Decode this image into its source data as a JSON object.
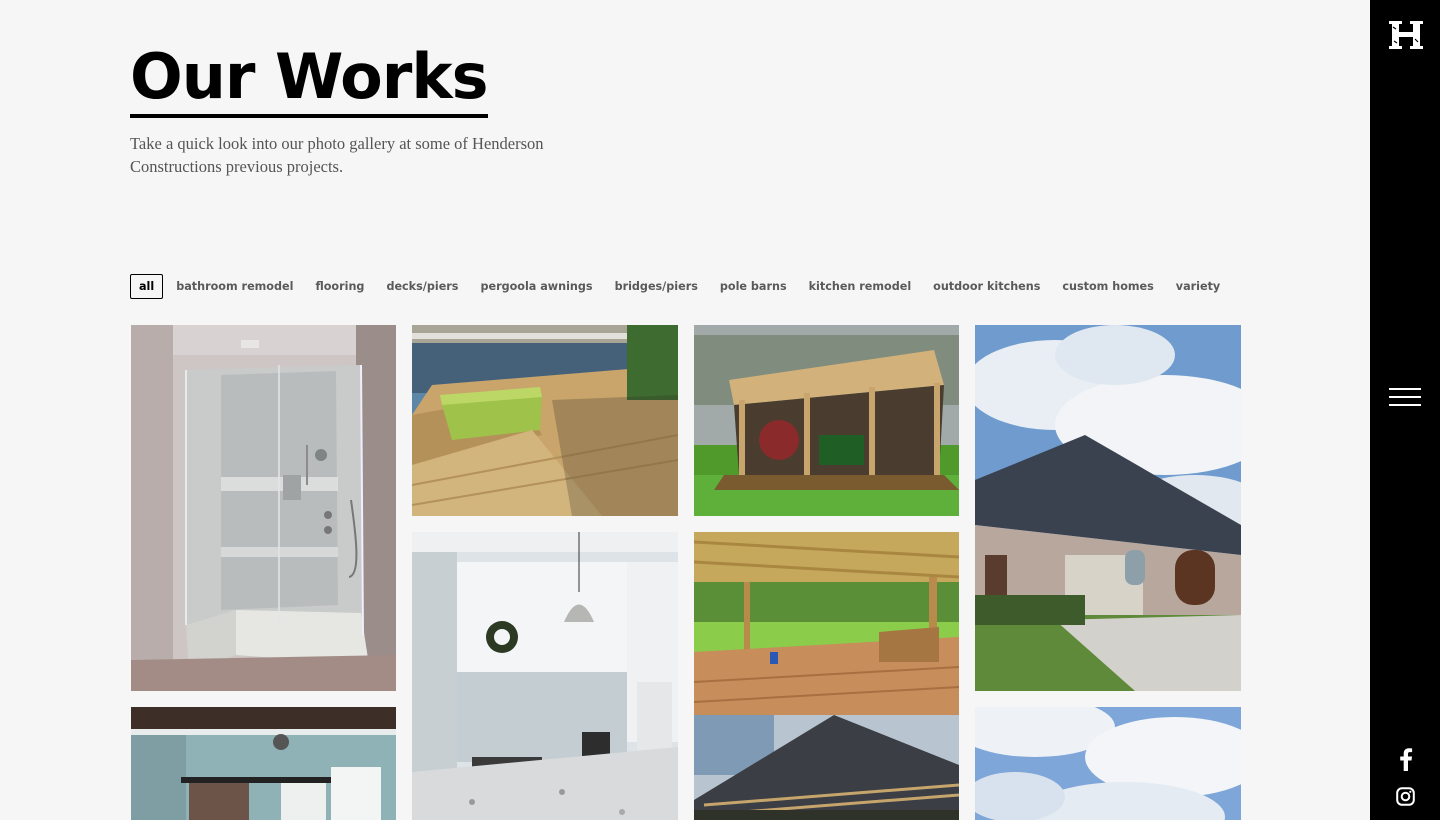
{
  "header": {
    "title": "Our Works",
    "intro": "Take a quick look into our photo gallery at some of Henderson Constructions previous projects."
  },
  "filters": [
    {
      "label": "all",
      "active": true
    },
    {
      "label": "bathroom remodel",
      "active": false
    },
    {
      "label": "flooring",
      "active": false
    },
    {
      "label": "decks/piers",
      "active": false
    },
    {
      "label": "pergoola awnings",
      "active": false
    },
    {
      "label": "bridges/piers",
      "active": false
    },
    {
      "label": "pole barns",
      "active": false
    },
    {
      "label": "kitchen remodel",
      "active": false
    },
    {
      "label": "outdoor kitchens",
      "active": false
    },
    {
      "label": "custom homes",
      "active": false
    },
    {
      "label": "variety",
      "active": false
    }
  ],
  "gallery": {
    "items": [
      {
        "name": "gallery-photo-walk-in-shower"
      },
      {
        "name": "gallery-photo-lake-pier-deck"
      },
      {
        "name": "gallery-photo-pole-barn"
      },
      {
        "name": "gallery-photo-brick-custom-home"
      },
      {
        "name": "gallery-photo-white-kitchen"
      },
      {
        "name": "gallery-photo-covered-deck"
      },
      {
        "name": "gallery-photo-pergola-roof"
      },
      {
        "name": "gallery-photo-bedroom-barn-door"
      },
      {
        "name": "gallery-photo-cloudy-sky"
      }
    ]
  },
  "sidebar": {
    "logo_letter": "H",
    "icons": [
      "menu-icon",
      "facebook-icon",
      "instagram-icon"
    ]
  },
  "colors": {
    "background": "#f6f6f6",
    "sidebar": "#000000",
    "title": "#000000",
    "text": "#555555"
  }
}
